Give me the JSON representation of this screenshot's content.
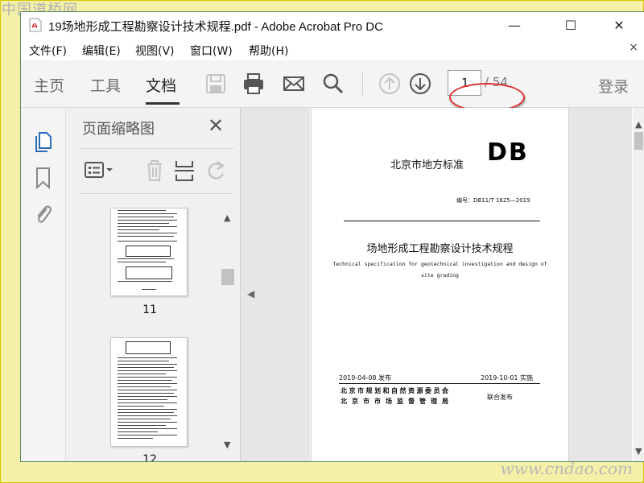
{
  "watermark_top": "中国道桥网",
  "watermark_bottom": "www.cndao.com",
  "titlebar": {
    "title": "19场地形成工程勘察设计技术规程.pdf - Adobe Acrobat Pro DC",
    "minimize": "—",
    "maximize": "☐",
    "close": "✕"
  },
  "menu": {
    "items": [
      "文件(F)",
      "编辑(E)",
      "视图(V)",
      "窗口(W)",
      "帮助(H)"
    ],
    "close": "×"
  },
  "toolbar": {
    "tabs": [
      "主页",
      "工具",
      "文档"
    ],
    "active_tab": "文档",
    "page_current": "1",
    "page_total": "/ 54",
    "login": "登录",
    "icons": [
      "save-icon",
      "print-icon",
      "email-icon",
      "search-icon",
      "page-up-icon",
      "page-down-icon"
    ]
  },
  "left_strip": {
    "icons": [
      "page-thumbnails-icon",
      "bookmark-icon",
      "attachment-icon"
    ]
  },
  "thumb_panel": {
    "title": "页面缩略图",
    "close": "✕",
    "pages": [
      "11",
      "12"
    ]
  },
  "document": {
    "header": "北京市地方标准",
    "logo": "DB",
    "code": "编号：DB11/T 1625—2019",
    "title": "场地形成工程勘察设计技术规程",
    "en_title_1": "Technical specification for geotechnical investigation and design of",
    "en_title_2": "site grading",
    "issue_date": "2019-04-08 发布",
    "impl_date": "2019-10-01 实施",
    "issuer_1": "北京市规划和自然资源委员会",
    "issuer_2": "北京市市场监督管理局",
    "joint": "联合发布"
  },
  "colors": {
    "background": "#f5f0a8",
    "highlight_circle": "#e03030",
    "toolbar": "#f4f4f4"
  }
}
